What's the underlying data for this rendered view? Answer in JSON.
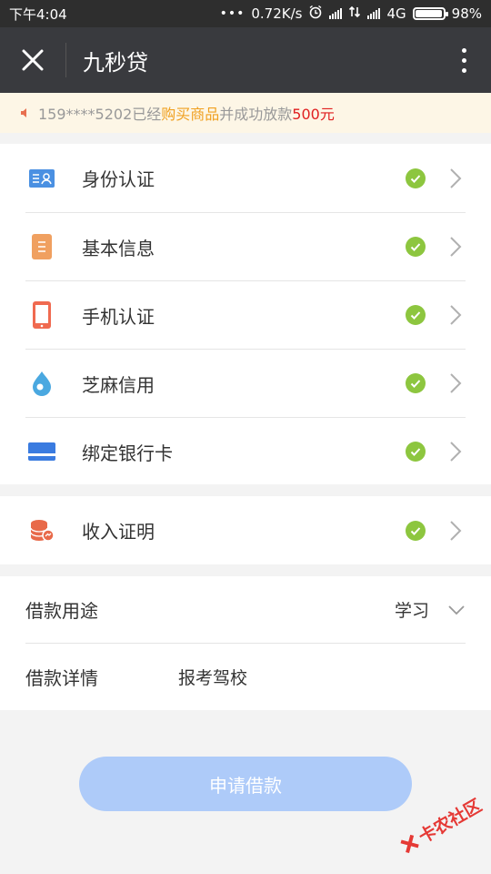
{
  "status_bar": {
    "time": "下午4:04",
    "speed": "0.72K/s",
    "network": "4G",
    "battery": "98%",
    "battery_level": 0.98
  },
  "nav": {
    "title": "九秒贷",
    "close_icon": "close-icon",
    "more_icon": "more-vertical-icon"
  },
  "notice": {
    "icon": "speaker-icon",
    "prefix": "159****5202已经",
    "highlight": "购买商品",
    "middle": "并成功放款",
    "amount": "500元"
  },
  "verification": [
    {
      "label": "身份认证",
      "icon": "id-card-icon",
      "color": "#4a90e2",
      "done": true
    },
    {
      "label": "基本信息",
      "icon": "document-icon",
      "color": "#f0a060",
      "done": true
    },
    {
      "label": "手机认证",
      "icon": "phone-icon",
      "color": "#f06a50",
      "done": true
    },
    {
      "label": "芝麻信用",
      "icon": "sesame-credit-icon",
      "color": "#4aa8e0",
      "done": true
    },
    {
      "label": "绑定银行卡",
      "icon": "bank-card-icon",
      "color": "#3a7be0",
      "done": true
    }
  ],
  "income": {
    "label": "收入证明",
    "icon": "coins-icon",
    "color": "#e86a4a",
    "done": true
  },
  "loan": {
    "purpose_label": "借款用途",
    "purpose_value": "学习",
    "detail_label": "借款详情",
    "detail_value": "报考驾校"
  },
  "apply_button": "申请借款",
  "watermark": "卡农社区",
  "colors": {
    "nav_bg": "#393a3e",
    "check_green": "#8dc63f",
    "button_blue": "#aecbf9",
    "notice_orange": "#f0a020",
    "notice_red": "#e02020"
  }
}
